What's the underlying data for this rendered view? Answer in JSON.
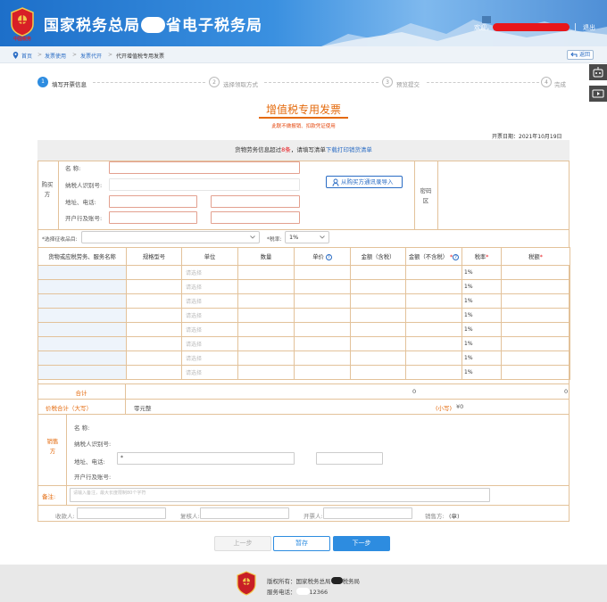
{
  "header": {
    "logo_text": "中国税务",
    "title_left": "国家税务总局",
    "title_right": "省电子税务局",
    "welcome": "欢迎，",
    "logout": "退出"
  },
  "breadcrumb": {
    "items": [
      "首页",
      "发票使用",
      "发票代开",
      "代开增值税专用发票"
    ],
    "separator": ">",
    "back": "返回"
  },
  "steps": [
    {
      "num": "1",
      "label": "填写开票信息",
      "active": true
    },
    {
      "num": "2",
      "label": "选择领取方式",
      "active": false
    },
    {
      "num": "3",
      "label": "预览提交",
      "active": false
    },
    {
      "num": "4",
      "label": "完成",
      "active": false
    }
  ],
  "doc": {
    "title": "增值税专用发票",
    "note": "此联不做报销、扣款凭证使用",
    "date": "开票日期：2021年10月19日"
  },
  "notice": {
    "prefix": "货物劳务信息超过",
    "count": "8条",
    "middle": "，请填写清单",
    "link": "下载打印销货清单"
  },
  "buyer": {
    "section": "购买方",
    "name_label": "名      称:",
    "tax_id_label": "纳税人识别号:",
    "address_label": "地址、电话:",
    "bank_label": "开户行及账号:",
    "import_button": "从购买方通讯录导入",
    "cipher_area": "密码区"
  },
  "options": {
    "category_label": "*选择征收品目:",
    "category_value": "",
    "rate_label": "*税率:",
    "rate_value": "1%"
  },
  "table": {
    "headers": [
      "货物或应税劳务、服务名称",
      "规格型号",
      "单位",
      "数量",
      "单价",
      "金额（含税）",
      "金额（不含税）",
      "税率",
      "税额"
    ],
    "unit_placeholder": "请选择",
    "rows": [
      {
        "rate": "1%"
      },
      {
        "rate": "1%"
      },
      {
        "rate": "1%"
      },
      {
        "rate": "1%"
      },
      {
        "rate": "1%"
      },
      {
        "rate": "1%"
      },
      {
        "rate": "1%"
      },
      {
        "rate": "1%"
      }
    ]
  },
  "totals": {
    "label": "合计",
    "amount": "0",
    "tax": "0",
    "total_label": "价税合计（大写）",
    "total_words": "零元整",
    "small_label": "(小写)",
    "small_value": "¥0"
  },
  "seller": {
    "section": "销售方",
    "name_label": "名      称:",
    "tax_id_label": "纳税人识别号:",
    "address_label": "地址、电话:",
    "bank_label": "开户行及账号:",
    "address_value": "*"
  },
  "remarks": {
    "label": "备注:",
    "placeholder": "请输入备注，最大长度限制80个字符"
  },
  "signers": {
    "payee": "收款人:",
    "reviewer": "复核人:",
    "issuer": "开票人:",
    "seller_label": "销售方:",
    "seal": "(章)"
  },
  "buttons": {
    "prev": "上一步",
    "save": "暂存",
    "next": "下一步"
  },
  "footer": {
    "copyright_prefix": "版权所有：国家税务总局",
    "copyright_suffix": "税务局",
    "phone_label": "服务电话：",
    "phone": "12366"
  },
  "colors": {
    "primary": "#2d8ce0",
    "accent_orange": "#e46a0c",
    "alert_red": "#e8161b",
    "form_border": "#e3c29a"
  }
}
